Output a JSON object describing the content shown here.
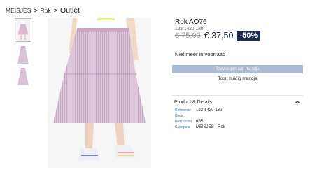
{
  "breadcrumb": {
    "items": [
      "MEISJES",
      "Rok"
    ],
    "separator": ">",
    "current": "Outlet"
  },
  "gallery": {
    "thumbnails": [
      {
        "name": "thumbnail-1",
        "active": true
      },
      {
        "name": "thumbnail-2",
        "active": false
      },
      {
        "name": "thumbnail-3",
        "active": false
      }
    ]
  },
  "product": {
    "title": "Rok AO76",
    "sku": "122-1420-130",
    "price_old": "€ 75,00",
    "price_new": "€ 37,50",
    "discount": "-50%",
    "stock_status": "Niet meer in voorraad",
    "add_to_cart_label": "Toevoegen aan mandje",
    "view_cart_label": "Toon huidig mandje"
  },
  "details": {
    "title": "Product & Details",
    "rows": [
      {
        "label": "Referentie",
        "value": "122-1420-130"
      },
      {
        "label": "Kleur",
        "value": ""
      },
      {
        "label": "leverancier",
        "value": "655"
      },
      {
        "label": "Categorie",
        "value": "MEISJES - Rok"
      }
    ]
  },
  "colors": {
    "accent": "#1f2b4d",
    "button_disabled": "#a9bcd4",
    "link_label": "#3c6eb4",
    "skirt": "#d6bcd2"
  }
}
